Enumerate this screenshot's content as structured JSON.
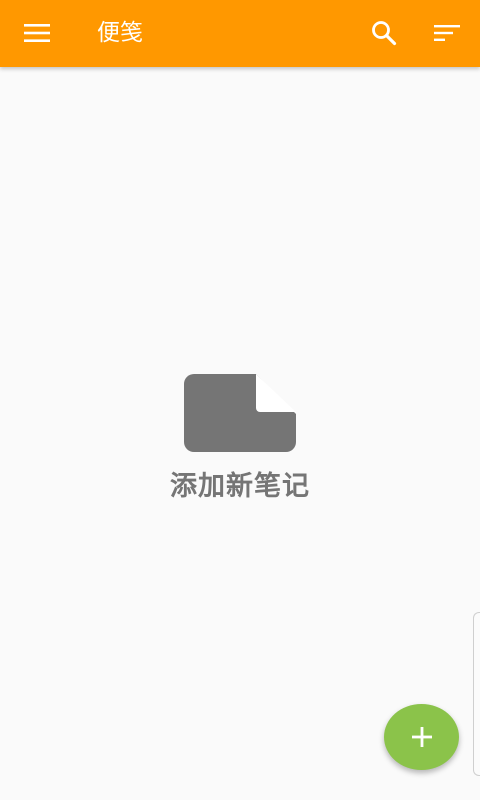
{
  "appbar": {
    "title": "便笺",
    "color": "#ff9800",
    "menu_icon": "hamburger-menu-icon",
    "search_icon": "search-icon",
    "sort_icon": "sort-icon"
  },
  "empty_state": {
    "icon": "note-file-icon",
    "message": "添加新笔记",
    "icon_color": "#757575"
  },
  "fab": {
    "icon": "plus-icon",
    "color": "#8bc34a"
  }
}
